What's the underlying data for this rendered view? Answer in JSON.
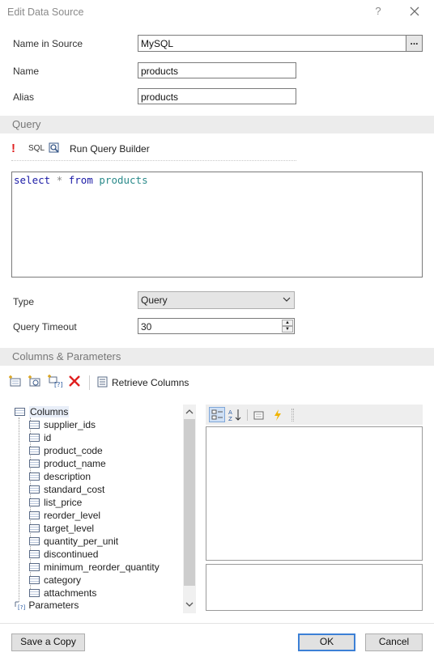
{
  "window": {
    "title": "Edit Data Source",
    "help_label": "?"
  },
  "form": {
    "name_in_source_label": "Name in Source",
    "name_in_source_value": "MySQL",
    "ellipsis_label": "...",
    "name_label": "Name",
    "name_value": "products",
    "alias_label": "Alias",
    "alias_value": "products"
  },
  "query": {
    "section_title": "Query",
    "sql_label": "SQL",
    "run_builder_label": "Run Query Builder",
    "sql_tokens": [
      "select",
      "*",
      "from",
      "products"
    ],
    "type_label": "Type",
    "type_value": "Query",
    "timeout_label": "Query Timeout",
    "timeout_value": "30"
  },
  "columns": {
    "section_title": "Columns & Parameters",
    "retrieve_label": "Retrieve Columns",
    "root_label": "Columns",
    "items": [
      "supplier_ids",
      "id",
      "product_code",
      "product_name",
      "description",
      "standard_cost",
      "list_price",
      "reorder_level",
      "target_level",
      "quantity_per_unit",
      "discontinued",
      "minimum_reorder_quantity",
      "category",
      "attachments"
    ],
    "parameters_label": "Parameters"
  },
  "buttons": {
    "save_copy": "Save a Copy",
    "ok": "OK",
    "cancel": "Cancel"
  },
  "colors": {
    "accent": "#3c80d6",
    "section_bg": "#ececec",
    "delete_red": "#e02020",
    "keyword_blue": "#1a1aa6"
  }
}
